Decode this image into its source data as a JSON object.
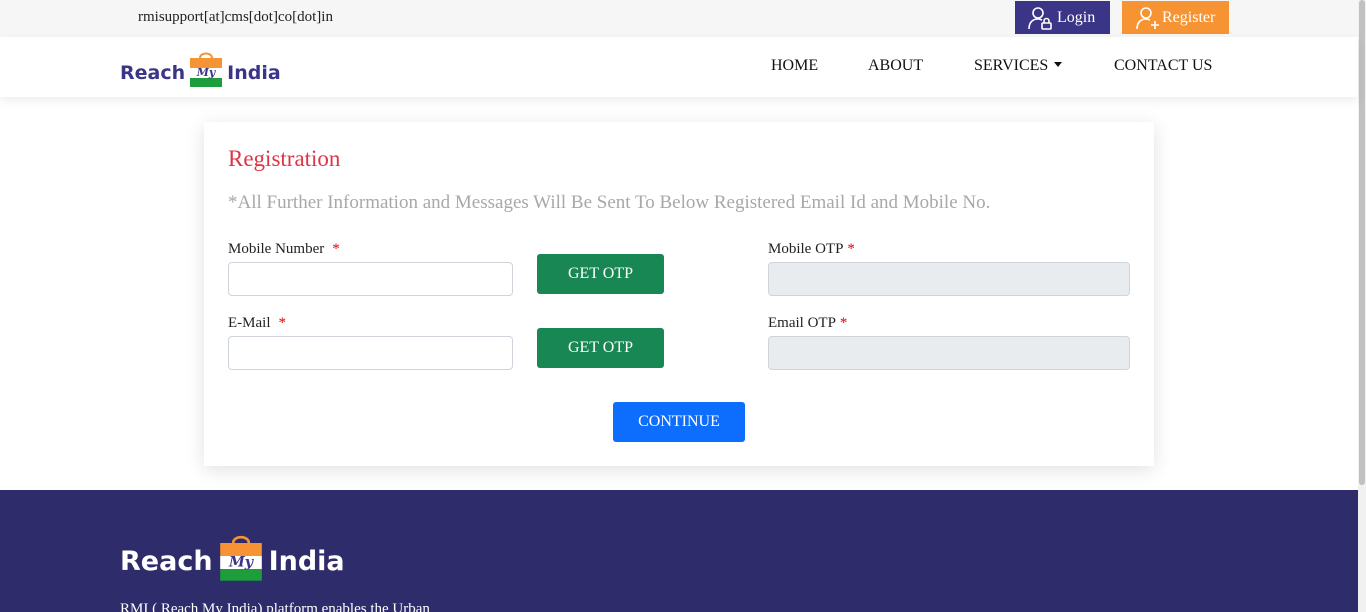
{
  "topbar": {
    "email": "rmisupport[at]cms[dot]co[dot]in",
    "login_label": "Login",
    "register_label": "Register"
  },
  "brand": {
    "word_left": "Reach",
    "word_middle": "My",
    "word_right": "India"
  },
  "nav": {
    "items": [
      "HOME",
      "ABOUT",
      "SERVICES",
      "CONTACT US"
    ]
  },
  "form": {
    "title": "Registration",
    "note": "*All Further Information and Messages Will Be Sent To Below Registered Email Id and Mobile No.",
    "mobile_label": "Mobile Number",
    "email_label": "E-Mail",
    "mobile_otp_label": "Mobile OTP",
    "email_otp_label": "Email OTP",
    "required_mark": "*",
    "get_otp_label": "GET OTP",
    "continue_label": "CONTINUE",
    "mobile_value": "",
    "email_value": "",
    "mobile_otp_value": "",
    "email_otp_value": ""
  },
  "footer": {
    "text": "RMI ( Reach My India) platform enables the Urban"
  },
  "colors": {
    "brand_purple": "#3b3587",
    "brand_orange": "#f69333",
    "title_red": "#dc3545",
    "otp_green": "#198754",
    "continue_blue": "#0d6efd",
    "footer_bg": "#2f2c6b"
  },
  "icons": {
    "login": "user-lock-icon",
    "register": "user-plus-icon",
    "services_caret": "caret-down-icon",
    "logo_bag": "shopping-bag-icon"
  }
}
